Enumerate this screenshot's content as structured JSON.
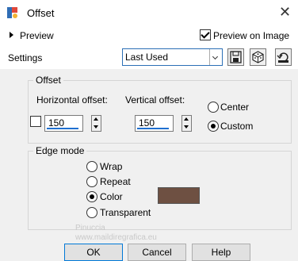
{
  "window": {
    "title": "Offset"
  },
  "preview": {
    "label": "Preview",
    "on_image_label": "Preview on Image",
    "on_image_checked": true
  },
  "settings": {
    "label": "Settings",
    "preset_value": "Last Used"
  },
  "offset": {
    "group_title": "Offset",
    "horizontal_label": "Horizontal offset:",
    "vertical_label": "Vertical offset:",
    "horizontal_value": "150",
    "vertical_value": "150",
    "link_checked": false,
    "center_label": "Center",
    "custom_label": "Custom",
    "selected": "Custom"
  },
  "edge_mode": {
    "group_title": "Edge mode",
    "options": [
      "Wrap",
      "Repeat",
      "Color",
      "Transparent"
    ],
    "selected": "Color",
    "color": "#6e5042"
  },
  "buttons": {
    "ok": "OK",
    "cancel": "Cancel",
    "help": "Help"
  },
  "watermark": {
    "text": "Pinuccia",
    "url": "www.maildiregrafica.eu"
  },
  "icons": [
    "app-icon",
    "close-icon",
    "expand-triangle-icon",
    "save-preset-icon",
    "randomize-dice-icon",
    "reset-icon"
  ]
}
